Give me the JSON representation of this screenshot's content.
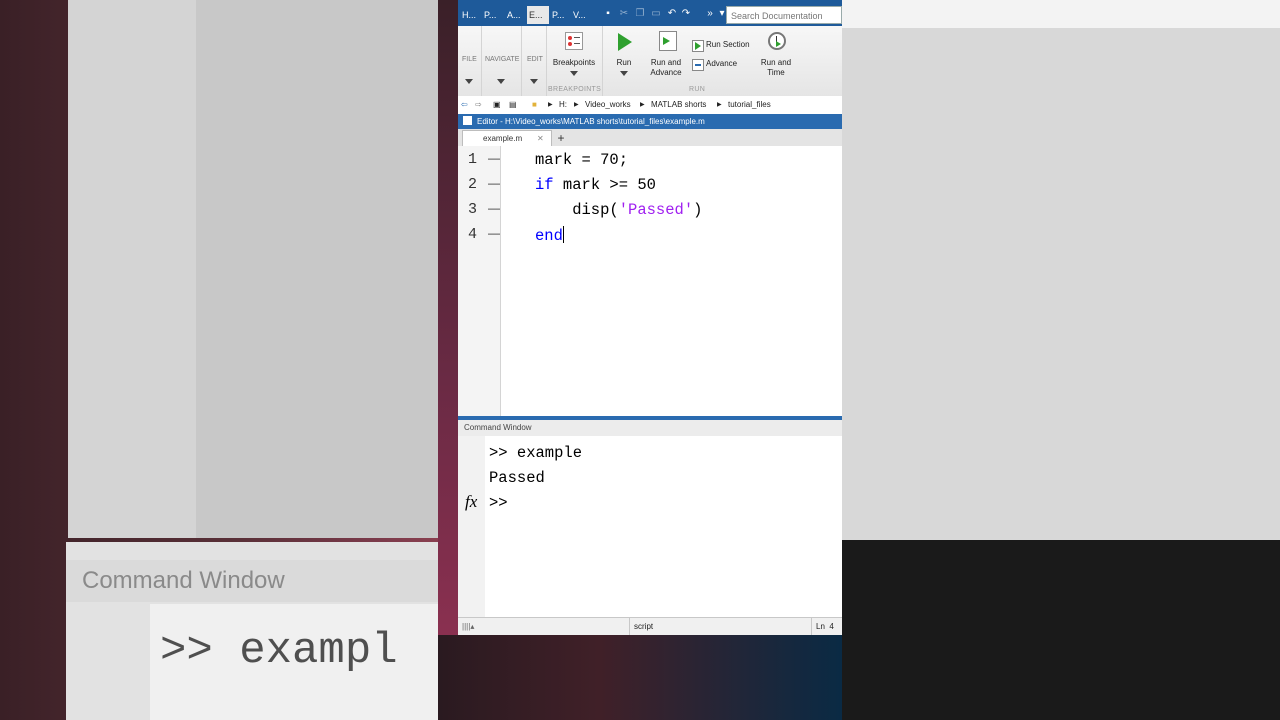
{
  "background": {
    "big_command_title": "Command Window",
    "big_command_text": ">> exampl"
  },
  "tabs": [
    {
      "label": "H..."
    },
    {
      "label": "P..."
    },
    {
      "label": "A..."
    },
    {
      "label": "E..."
    },
    {
      "label": "P..."
    },
    {
      "label": "V..."
    }
  ],
  "search": {
    "placeholder": "Search Documentation"
  },
  "ribbon": {
    "file": "FILE",
    "navigate": "NAVIGATE",
    "edit": "EDIT",
    "breakpoints": "Breakpoints",
    "breakpoints_group": "BREAKPOINTS",
    "run": "Run",
    "run_and_advance_1": "Run and",
    "run_and_advance_2": "Advance",
    "run_section": "Run Section",
    "advance": "Advance",
    "run_and_time_1": "Run and",
    "run_and_time_2": "Time",
    "run_group": "RUN"
  },
  "address": {
    "drive": "H:",
    "path": [
      "Video_works",
      "MATLAB shorts",
      "tutorial_files"
    ]
  },
  "editor": {
    "title": "Editor - H:\\Video_works\\MATLAB shorts\\tutorial_files\\example.m",
    "tab_label": "example.m",
    "lines": [
      {
        "num": "1",
        "text": "mark = 70;"
      },
      {
        "num": "2",
        "kw": "if",
        "rest": " mark >= 50"
      },
      {
        "num": "3",
        "pre": "    disp(",
        "str": "'Passed'",
        "post": ")"
      },
      {
        "num": "4",
        "kw": "end"
      }
    ]
  },
  "command_window": {
    "title": "Command Window",
    "lines": [
      ">> example",
      "Passed",
      ">>"
    ],
    "fx": "fx"
  },
  "status": {
    "mode": "script",
    "ln_label": "Ln",
    "ln_value": "4"
  }
}
